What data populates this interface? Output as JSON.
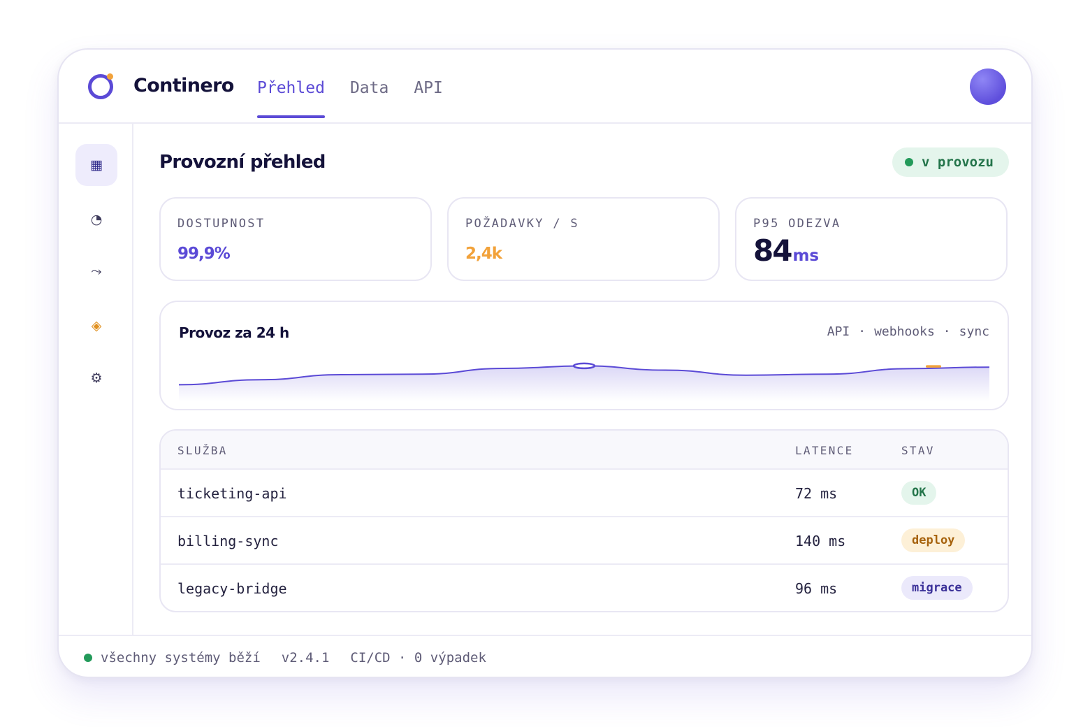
{
  "app": {
    "name": "Continero"
  },
  "nav": {
    "tabs": [
      {
        "label": "Přehled",
        "active": true
      },
      {
        "label": "Data"
      },
      {
        "label": "API"
      }
    ]
  },
  "sidebar": {
    "items": [
      {
        "icon": "grid-icon",
        "glyph": "▦",
        "active": true
      },
      {
        "icon": "pie-chart-icon",
        "glyph": "◔"
      },
      {
        "icon": "flow-icon",
        "glyph": "⤳"
      },
      {
        "icon": "diamond-icon",
        "glyph": "◈",
        "color": "#e0901f"
      },
      {
        "icon": "gear-icon",
        "glyph": "⚙"
      }
    ]
  },
  "page": {
    "title": "Provozní přehled",
    "status": "v provozu"
  },
  "kpis": [
    {
      "label": "DOSTUPNOST",
      "value": "99,9%",
      "color": "#5b4ad6"
    },
    {
      "label": "POŽADAVKY / S",
      "value": "2,4k",
      "color": "#f2a23a"
    },
    {
      "label": "P95 ODEZVA",
      "value": "84",
      "unit": "ms"
    }
  ],
  "chart_data": {
    "type": "area",
    "title": "Provoz za 24 h",
    "legend": [
      "API",
      "webhooks",
      "sync"
    ],
    "x": [
      0,
      1,
      2,
      3,
      4,
      5,
      6,
      7,
      8,
      9,
      10
    ],
    "values": [
      0.1,
      0.3,
      0.5,
      0.52,
      0.75,
      0.85,
      0.68,
      0.48,
      0.52,
      0.74,
      0.8
    ],
    "grid": false,
    "colors": {
      "line": "#5b4ad6",
      "marker": "#f2a23a"
    }
  },
  "table": {
    "headers": {
      "service": "SLUŽBA",
      "latency": "LATENCE",
      "status": "STAV"
    },
    "rows": [
      {
        "service": "ticketing-api",
        "latency": "72 ms",
        "status": "OK",
        "status_color": "#23744a",
        "status_bg": "#e4f5ec"
      },
      {
        "service": "billing-sync",
        "latency": "140 ms",
        "status": "deploy",
        "status_color": "#a6620c",
        "status_bg": "#fdf0d7"
      },
      {
        "service": "legacy-bridge",
        "latency": "96 ms",
        "status": "migrace",
        "status_color": "#3b3199",
        "status_bg": "#ebe9fb"
      }
    ]
  },
  "footer": {
    "status": "všechny systémy běží",
    "version": "v2.4.1",
    "pipeline": "CI/CD · 0 výpadek"
  }
}
